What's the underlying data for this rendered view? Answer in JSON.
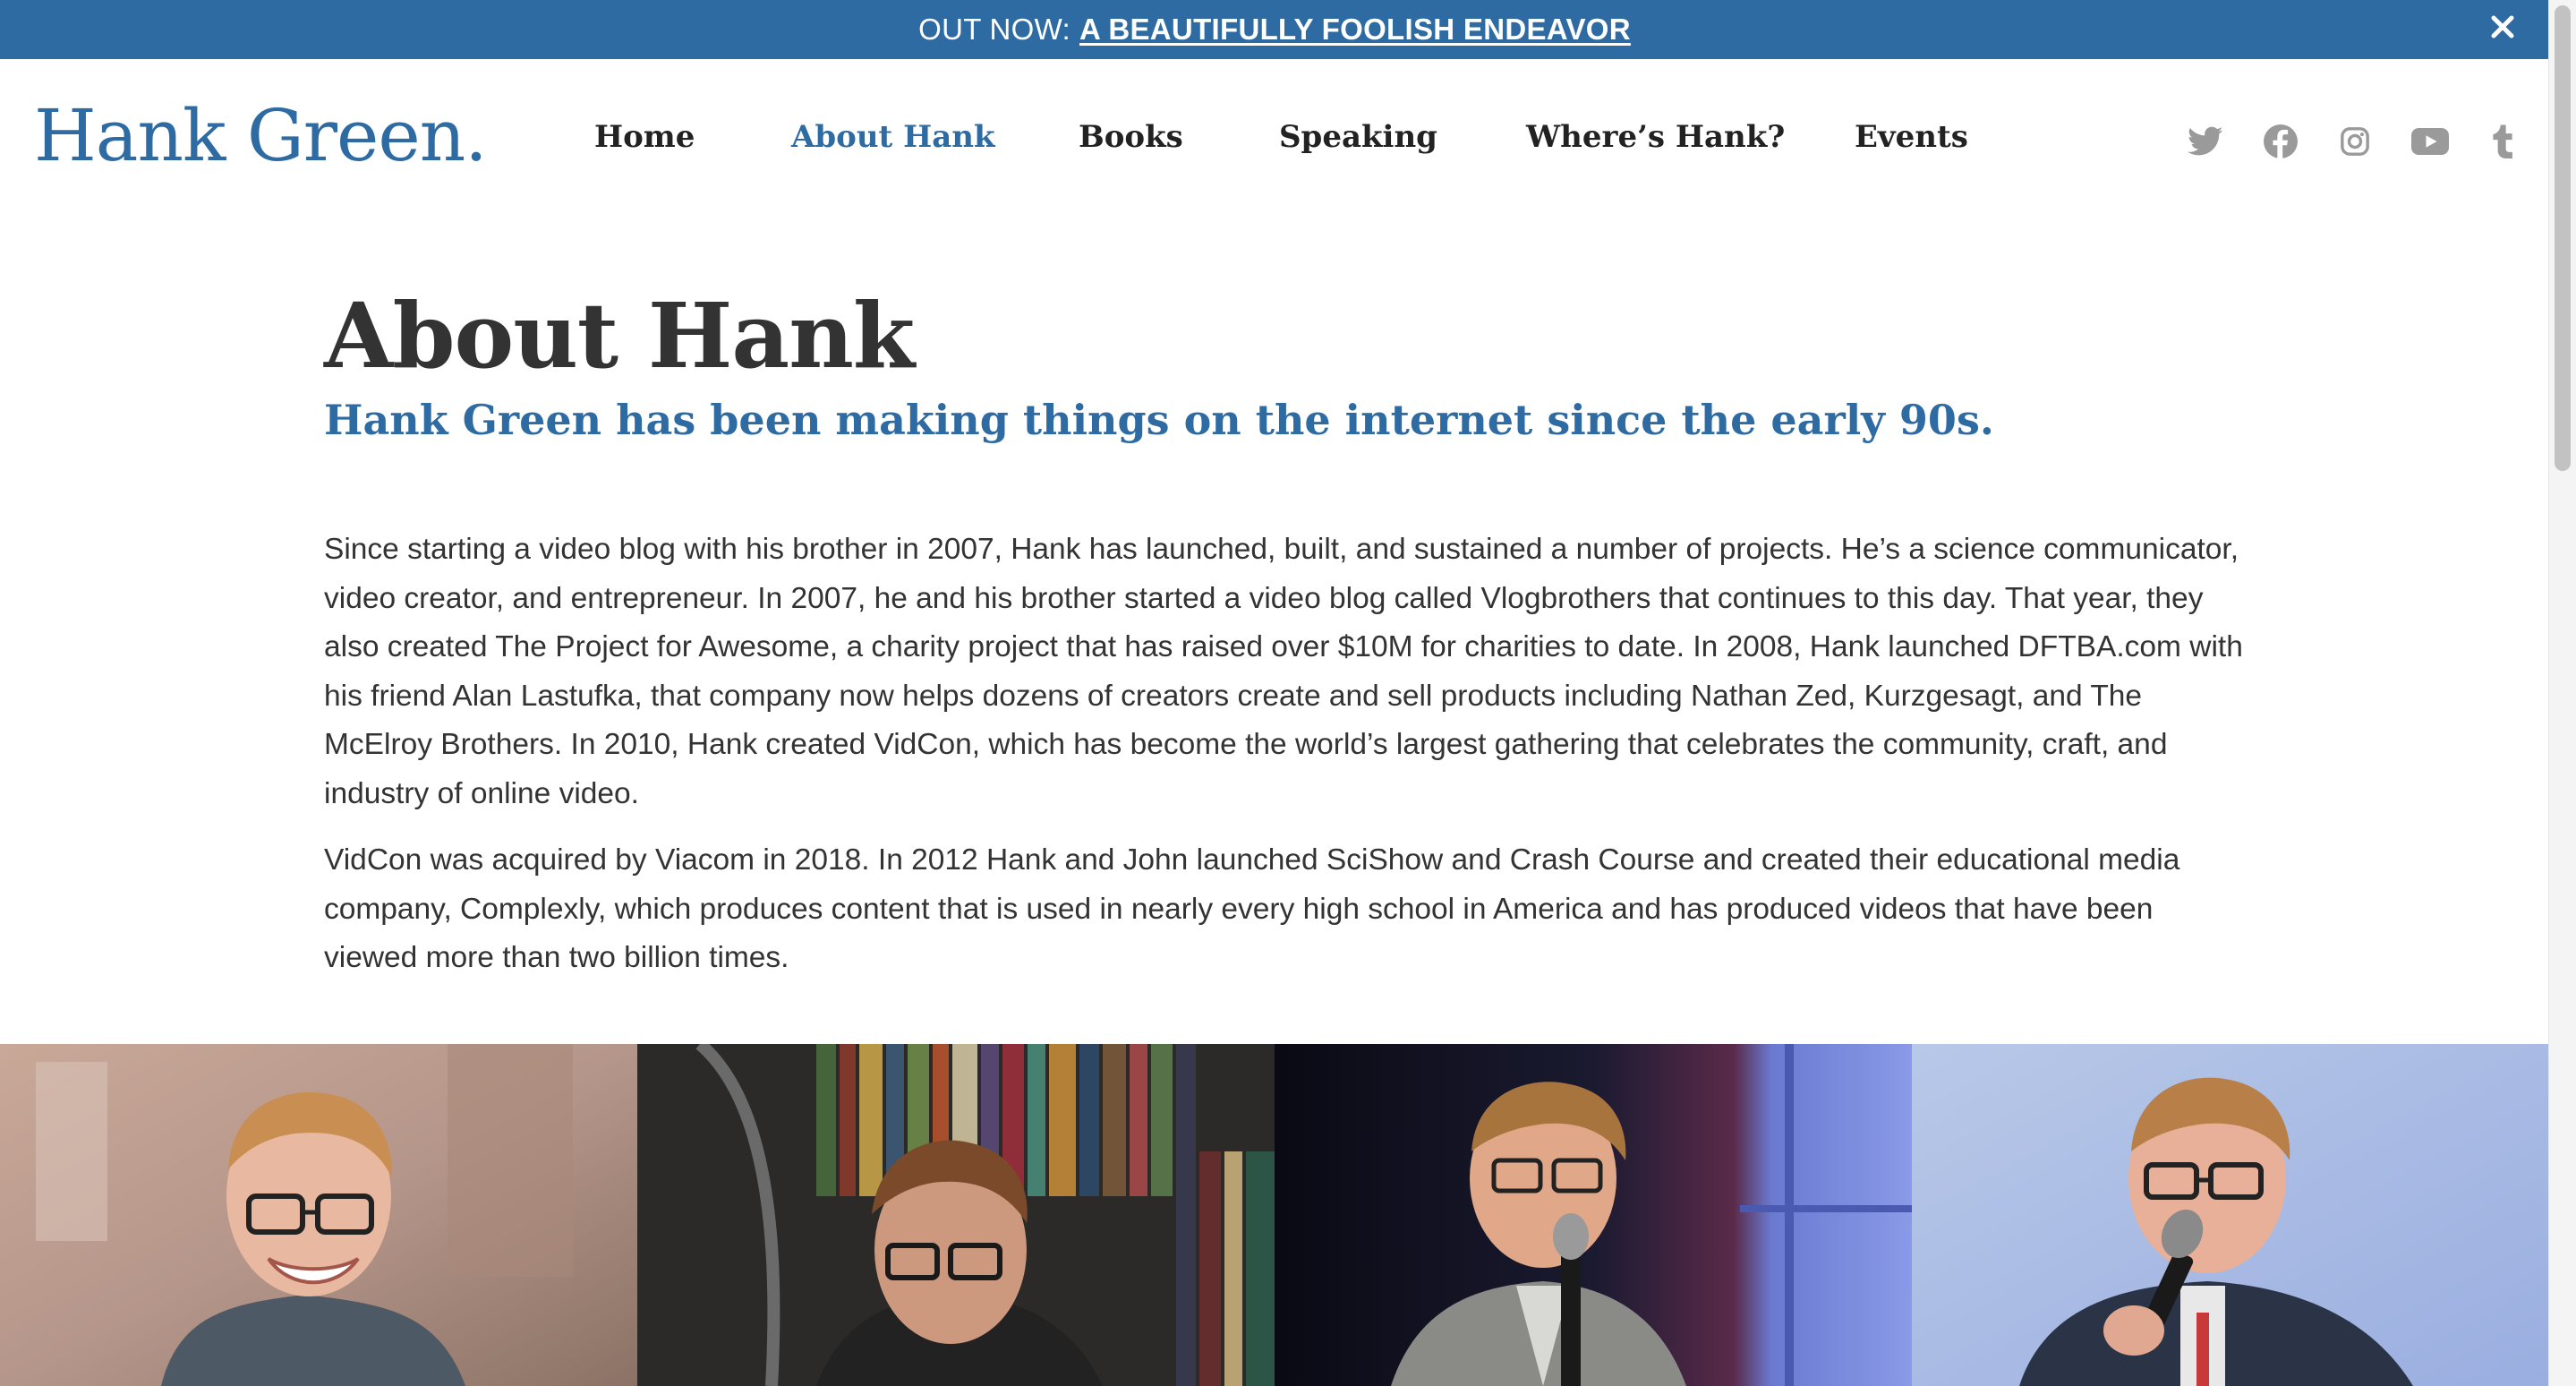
{
  "announcement": {
    "prefix": "OUT NOW:",
    "link_text": "A BEAUTIFULLY FOOLISH ENDEAVOR",
    "close_icon": "close-icon",
    "background": "#2f6ba3"
  },
  "header": {
    "logo": "Hank Green.",
    "nav": [
      {
        "label": "Home",
        "active": false
      },
      {
        "label": "About Hank",
        "active": true
      },
      {
        "label": "Books",
        "active": false
      },
      {
        "label": "Speaking",
        "active": false
      },
      {
        "label": "Where’s Hank?",
        "active": false
      },
      {
        "label": "Events",
        "active": false
      }
    ],
    "social_icons": [
      "twitter-icon",
      "facebook-icon",
      "instagram-icon",
      "youtube-icon",
      "tumblr-icon"
    ]
  },
  "main": {
    "title": "About Hank",
    "subtitle": "Hank Green has been making things on the internet since the early 90s.",
    "paragraphs": [
      "Since starting a video blog with his brother in 2007, Hank has launched, built, and sustained a number of projects. He’s a science communicator, video creator, and entrepreneur. In 2007, he and his brother started a video blog called Vlogbrothers that continues to this day. That year, they also created The Project for Awesome, a charity project that has raised over $10M for charities to date. In 2008, Hank launched DFTBA.com with his friend Alan Lastufka, that company now helps dozens of creators create and sell products including Nathan Zed, Kurzgesagt, and The McElroy Brothers. In 2010, Hank created VidCon, which has become the world’s largest gathering that celebrates the community, craft, and industry of online video.",
      "VidCon was acquired by Viacom in 2018. In 2012 Hank and John launched SciShow and Crash Course and created their educational media company, Complexly, which produces content that is used in nearly every high school in America and has produced videos that have been viewed more than two billion times."
    ]
  },
  "colors": {
    "accent": "#2f6ba3",
    "text": "#333333",
    "nav_text": "#222222",
    "social_icon": "#9a9a9a"
  }
}
